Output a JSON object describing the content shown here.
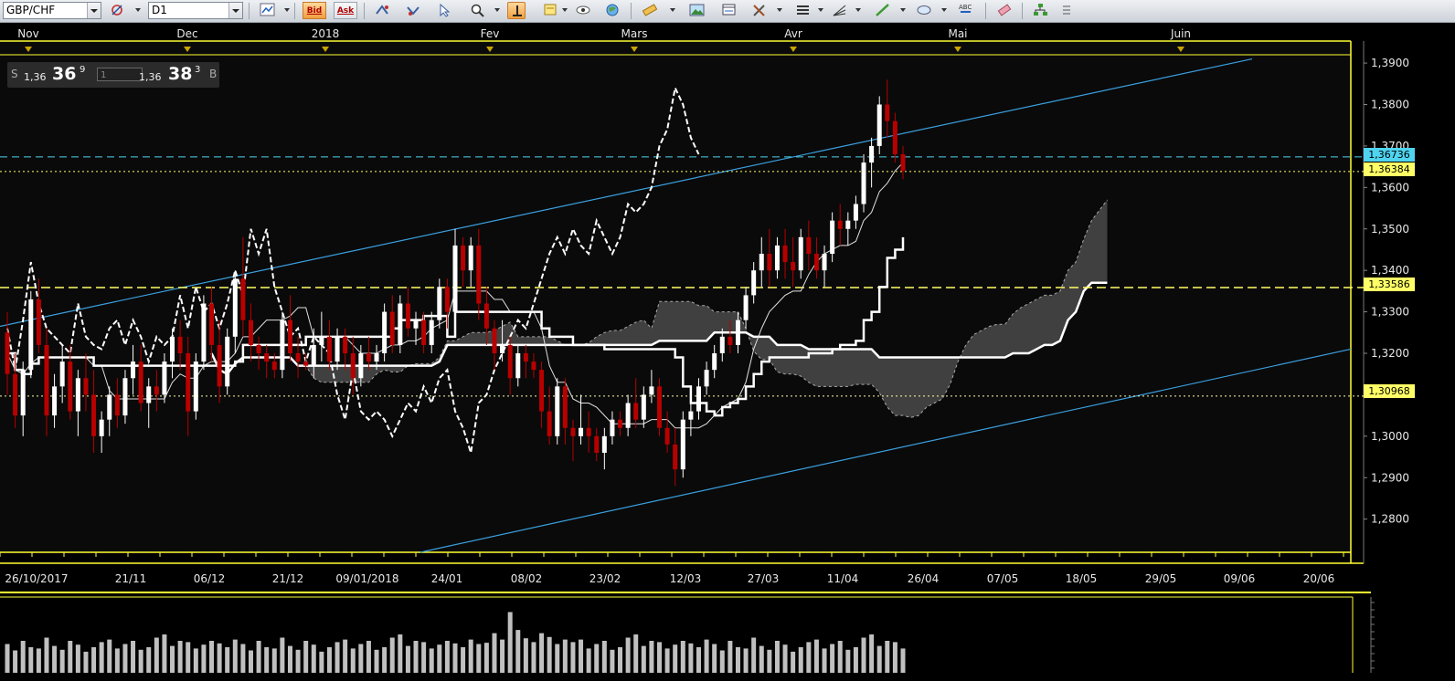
{
  "toolbar": {
    "symbol": "GBP/CHF",
    "timeframe": "D1",
    "bid_label": "Bid",
    "ask_label": "Ask"
  },
  "quote": {
    "sell_label": "S",
    "sell_prefix": "1,36",
    "sell_big": "36",
    "sell_sup": "9",
    "lot_value": "1",
    "buy_prefix": "1,36",
    "buy_big": "38",
    "buy_sup": "3",
    "buy_label": "B"
  },
  "price_axis": {
    "labels": [
      "1,3900",
      "1,3800",
      "1,3700",
      "1,3600",
      "1,3500",
      "1,3400",
      "1,3300",
      "1,3200",
      "1,3000",
      "1,2900",
      "1,2800"
    ],
    "values": [
      1.39,
      1.38,
      1.37,
      1.36,
      1.35,
      1.34,
      1.33,
      1.32,
      1.3,
      1.29,
      1.28
    ]
  },
  "price_tags": [
    {
      "label": "1,36736",
      "color": "#4fd4f0"
    },
    {
      "label": "1,36384",
      "color": "#ffff66"
    },
    {
      "label": "1,33586",
      "color": "#ffff66"
    },
    {
      "label": "1,30968",
      "color": "#ffff66"
    }
  ],
  "months": [
    "Nov",
    "Dec",
    "2018",
    "Fev",
    "Mars",
    "Avr",
    "Mai",
    "Juin"
  ],
  "dates": [
    "26/10/2017",
    "21/11",
    "06/12",
    "21/12",
    "09/01/2018",
    "24/01",
    "08/02",
    "23/02",
    "12/03",
    "27/03",
    "11/04",
    "26/04",
    "07/05",
    "18/05",
    "29/05",
    "09/06",
    "20/06"
  ],
  "colors": {
    "background": "#0a0a0a",
    "frame": "#ffff33",
    "trendline": "#3aa0e0",
    "bear_candle": "#b80000",
    "bull_candle": "#ffffff",
    "cloud": "#4a4a4a",
    "volume": "#c0c0c0"
  },
  "chart_data": {
    "type": "candlestick",
    "symbol": "GBP/CHF",
    "timeframe": "D1",
    "ylim": [
      1.272,
      1.392
    ],
    "levels": [
      1.36736,
      1.36384,
      1.33586,
      1.30968
    ],
    "candles": [
      [
        1.325,
        1.33,
        1.31,
        1.315
      ],
      [
        1.315,
        1.32,
        1.302,
        1.305
      ],
      [
        1.305,
        1.318,
        1.3,
        1.316
      ],
      [
        1.316,
        1.335,
        1.314,
        1.333
      ],
      [
        1.333,
        1.338,
        1.32,
        1.322
      ],
      [
        1.322,
        1.326,
        1.3,
        1.305
      ],
      [
        1.305,
        1.315,
        1.302,
        1.312
      ],
      [
        1.312,
        1.322,
        1.308,
        1.318
      ],
      [
        1.318,
        1.322,
        1.304,
        1.306
      ],
      [
        1.306,
        1.316,
        1.3,
        1.314
      ],
      [
        1.314,
        1.32,
        1.306,
        1.31
      ],
      [
        1.31,
        1.316,
        1.296,
        1.3
      ],
      [
        1.3,
        1.306,
        1.296,
        1.304
      ],
      [
        1.304,
        1.312,
        1.3,
        1.31
      ],
      [
        1.31,
        1.314,
        1.302,
        1.305
      ],
      [
        1.305,
        1.316,
        1.303,
        1.314
      ],
      [
        1.314,
        1.322,
        1.31,
        1.318
      ],
      [
        1.318,
        1.322,
        1.306,
        1.308
      ],
      [
        1.308,
        1.314,
        1.302,
        1.312
      ],
      [
        1.312,
        1.316,
        1.306,
        1.31
      ],
      [
        1.31,
        1.32,
        1.308,
        1.318
      ],
      [
        1.318,
        1.326,
        1.314,
        1.324
      ],
      [
        1.324,
        1.328,
        1.316,
        1.32
      ],
      [
        1.32,
        1.324,
        1.3,
        1.306
      ],
      [
        1.306,
        1.32,
        1.304,
        1.318
      ],
      [
        1.318,
        1.334,
        1.316,
        1.332
      ],
      [
        1.332,
        1.336,
        1.318,
        1.322
      ],
      [
        1.322,
        1.328,
        1.308,
        1.312
      ],
      [
        1.312,
        1.326,
        1.31,
        1.324
      ],
      [
        1.324,
        1.34,
        1.32,
        1.338
      ],
      [
        1.338,
        1.348,
        1.324,
        1.328
      ],
      [
        1.328,
        1.332,
        1.318,
        1.322
      ],
      [
        1.322,
        1.324,
        1.316,
        1.32
      ],
      [
        1.32,
        1.322,
        1.314,
        1.318
      ],
      [
        1.318,
        1.32,
        1.314,
        1.316
      ],
      [
        1.316,
        1.33,
        1.314,
        1.328
      ],
      [
        1.328,
        1.334,
        1.318,
        1.32
      ],
      [
        1.32,
        1.324,
        1.314,
        1.318
      ],
      [
        1.318,
        1.32,
        1.316,
        1.317
      ],
      [
        1.317,
        1.326,
        1.314,
        1.322
      ],
      [
        1.322,
        1.33,
        1.318,
        1.324
      ],
      [
        1.324,
        1.328,
        1.316,
        1.318
      ],
      [
        1.318,
        1.326,
        1.316,
        1.324
      ],
      [
        1.324,
        1.326,
        1.316,
        1.32
      ],
      [
        1.32,
        1.324,
        1.31,
        1.314
      ],
      [
        1.314,
        1.322,
        1.312,
        1.32
      ],
      [
        1.32,
        1.324,
        1.316,
        1.318
      ],
      [
        1.318,
        1.322,
        1.316,
        1.32
      ],
      [
        1.32,
        1.332,
        1.318,
        1.33
      ],
      [
        1.33,
        1.334,
        1.32,
        1.322
      ],
      [
        1.322,
        1.334,
        1.32,
        1.332
      ],
      [
        1.332,
        1.336,
        1.324,
        1.326
      ],
      [
        1.326,
        1.33,
        1.322,
        1.328
      ],
      [
        1.328,
        1.33,
        1.32,
        1.322
      ],
      [
        1.322,
        1.33,
        1.32,
        1.328
      ],
      [
        1.328,
        1.338,
        1.326,
        1.336
      ],
      [
        1.336,
        1.338,
        1.326,
        1.33
      ],
      [
        1.33,
        1.35,
        1.328,
        1.346
      ],
      [
        1.346,
        1.348,
        1.336,
        1.34
      ],
      [
        1.34,
        1.348,
        1.336,
        1.346
      ],
      [
        1.346,
        1.35,
        1.328,
        1.332
      ],
      [
        1.332,
        1.336,
        1.322,
        1.326
      ],
      [
        1.326,
        1.328,
        1.316,
        1.32
      ],
      [
        1.32,
        1.328,
        1.318,
        1.322
      ],
      [
        1.322,
        1.324,
        1.31,
        1.314
      ],
      [
        1.314,
        1.322,
        1.312,
        1.32
      ],
      [
        1.32,
        1.322,
        1.314,
        1.318
      ],
      [
        1.318,
        1.32,
        1.314,
        1.316
      ],
      [
        1.316,
        1.318,
        1.302,
        1.306
      ],
      [
        1.306,
        1.312,
        1.298,
        1.3
      ],
      [
        1.3,
        1.314,
        1.298,
        1.312
      ],
      [
        1.312,
        1.314,
        1.298,
        1.302
      ],
      [
        1.302,
        1.304,
        1.294,
        1.3
      ],
      [
        1.3,
        1.31,
        1.298,
        1.302
      ],
      [
        1.302,
        1.306,
        1.296,
        1.3
      ],
      [
        1.3,
        1.302,
        1.294,
        1.296
      ],
      [
        1.296,
        1.302,
        1.292,
        1.3
      ],
      [
        1.3,
        1.306,
        1.298,
        1.304
      ],
      [
        1.304,
        1.306,
        1.3,
        1.302
      ],
      [
        1.302,
        1.31,
        1.3,
        1.308
      ],
      [
        1.308,
        1.314,
        1.302,
        1.304
      ],
      [
        1.304,
        1.312,
        1.302,
        1.31
      ],
      [
        1.31,
        1.316,
        1.308,
        1.312
      ],
      [
        1.312,
        1.314,
        1.3,
        1.302
      ],
      [
        1.302,
        1.306,
        1.296,
        1.298
      ],
      [
        1.298,
        1.302,
        1.288,
        1.292
      ],
      [
        1.292,
        1.306,
        1.29,
        1.304
      ],
      [
        1.304,
        1.31,
        1.3,
        1.306
      ],
      [
        1.306,
        1.314,
        1.304,
        1.312
      ],
      [
        1.312,
        1.318,
        1.31,
        1.316
      ],
      [
        1.316,
        1.322,
        1.314,
        1.32
      ],
      [
        1.32,
        1.326,
        1.318,
        1.324
      ],
      [
        1.324,
        1.328,
        1.32,
        1.322
      ],
      [
        1.322,
        1.33,
        1.32,
        1.328
      ],
      [
        1.328,
        1.336,
        1.326,
        1.334
      ],
      [
        1.334,
        1.342,
        1.332,
        1.34
      ],
      [
        1.34,
        1.348,
        1.336,
        1.344
      ],
      [
        1.344,
        1.35,
        1.336,
        1.34
      ],
      [
        1.34,
        1.348,
        1.338,
        1.346
      ],
      [
        1.346,
        1.35,
        1.338,
        1.342
      ],
      [
        1.342,
        1.348,
        1.336,
        1.34
      ],
      [
        1.34,
        1.35,
        1.338,
        1.348
      ],
      [
        1.348,
        1.352,
        1.34,
        1.344
      ],
      [
        1.344,
        1.348,
        1.338,
        1.34
      ],
      [
        1.34,
        1.346,
        1.336,
        1.344
      ],
      [
        1.344,
        1.354,
        1.342,
        1.352
      ],
      [
        1.352,
        1.356,
        1.346,
        1.35
      ],
      [
        1.35,
        1.354,
        1.346,
        1.352
      ],
      [
        1.352,
        1.358,
        1.35,
        1.356
      ],
      [
        1.356,
        1.368,
        1.354,
        1.366
      ],
      [
        1.366,
        1.372,
        1.36,
        1.37
      ],
      [
        1.37,
        1.382,
        1.368,
        1.38
      ],
      [
        1.38,
        1.386,
        1.372,
        1.376
      ],
      [
        1.376,
        1.378,
        1.366,
        1.368
      ],
      [
        1.368,
        1.37,
        1.362,
        1.364
      ]
    ],
    "volume_max": 1.0
  }
}
